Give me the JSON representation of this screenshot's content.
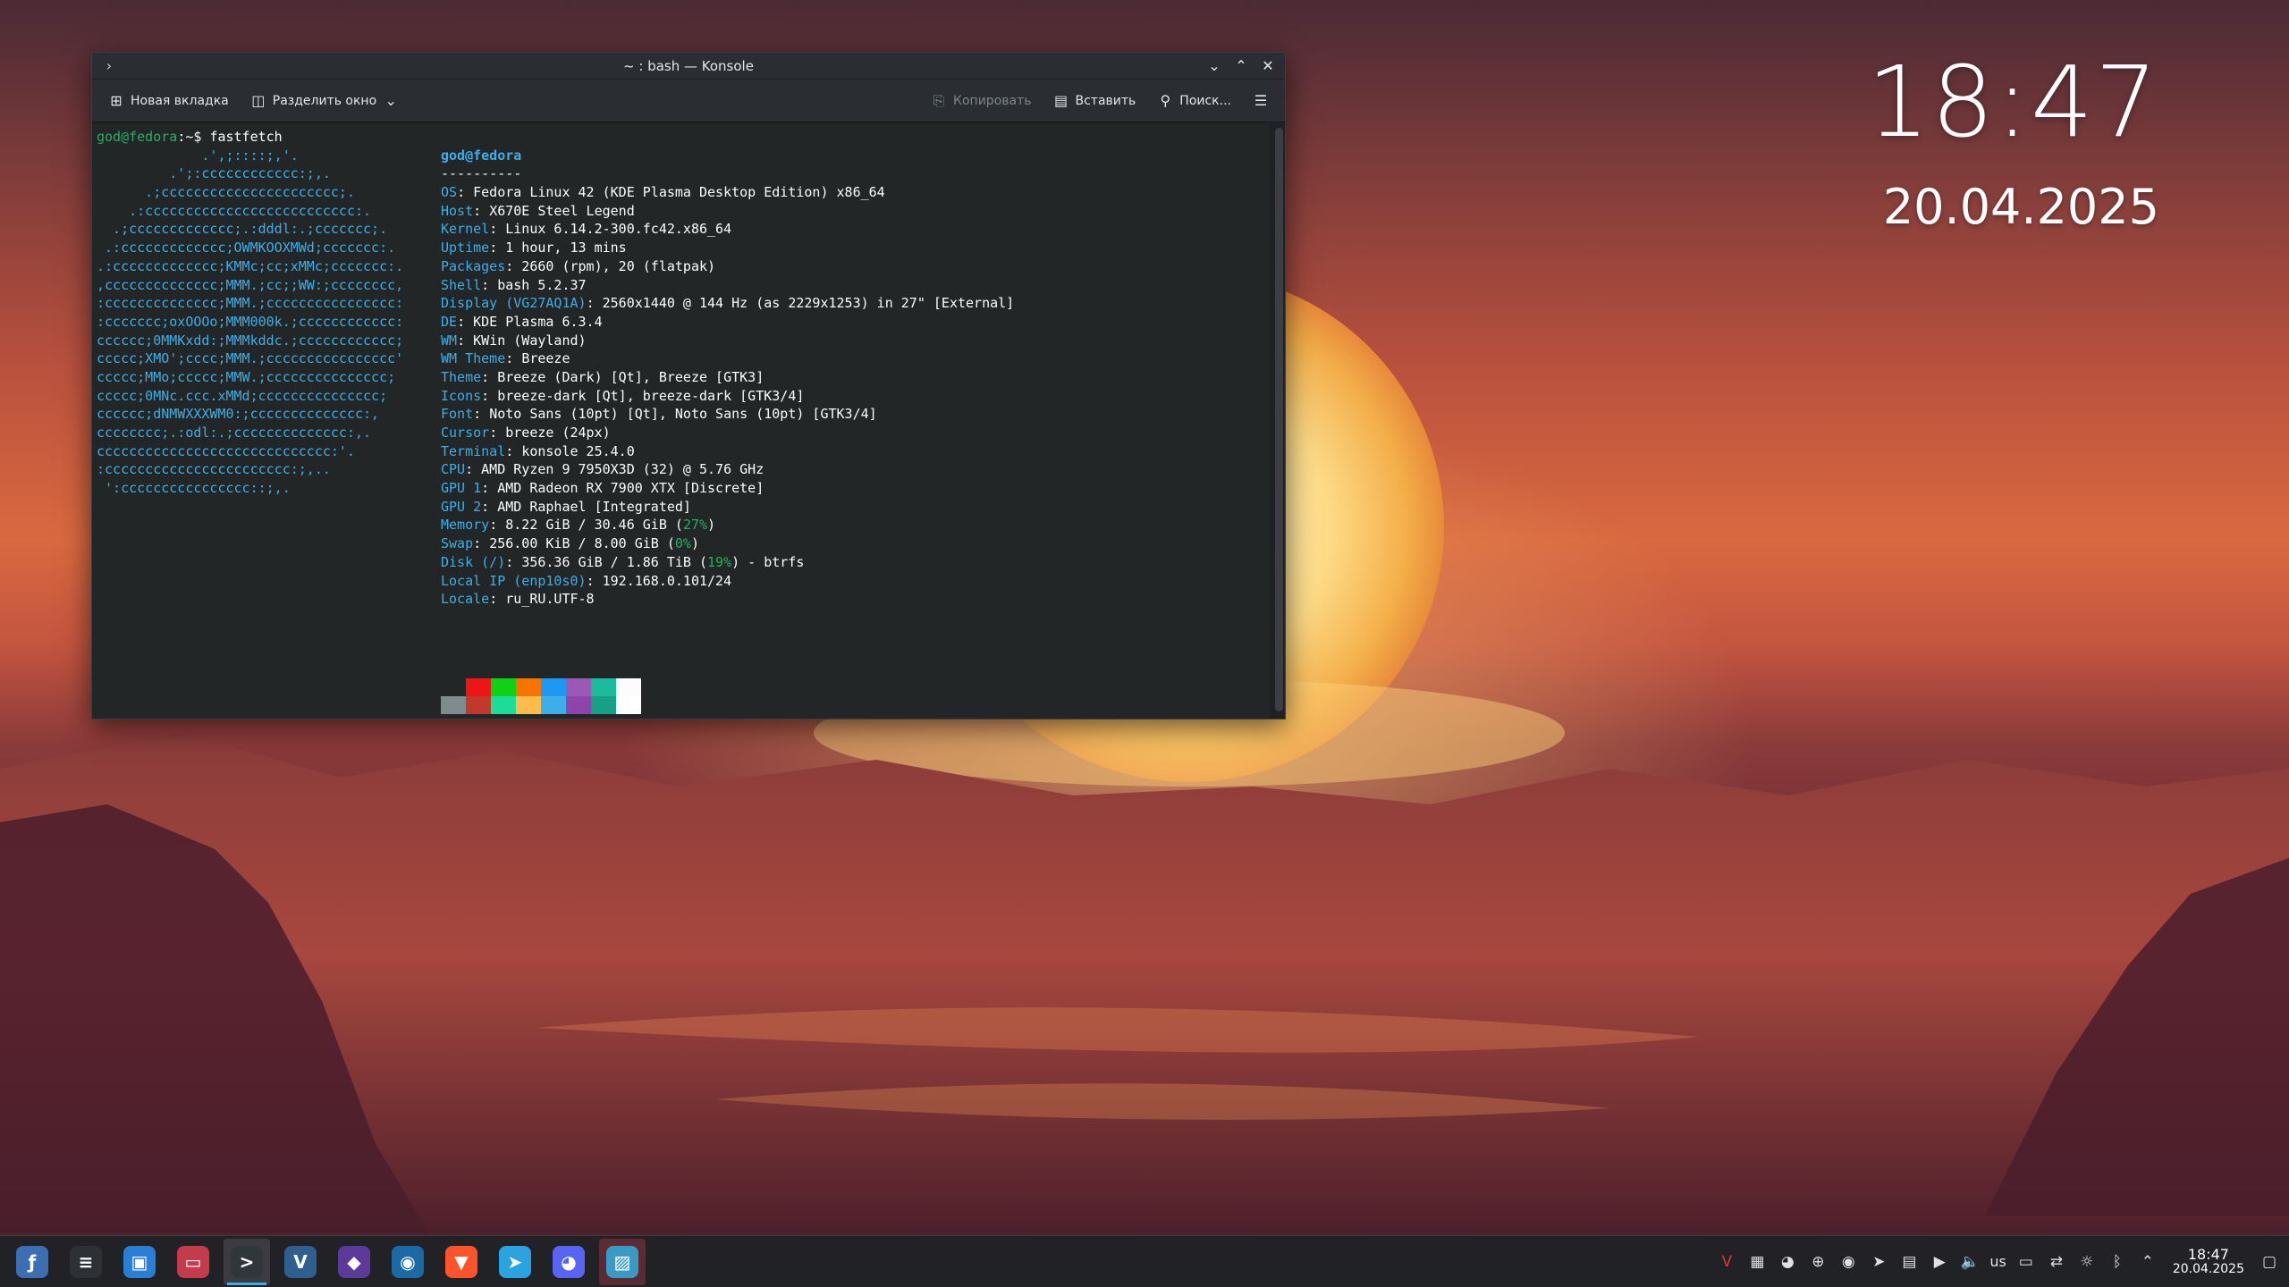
{
  "desktop": {
    "clock_time": "18:47",
    "clock_date": "20.04.2025"
  },
  "window": {
    "title": "~ : bash — Konsole",
    "app_icon": "terminal-chevron-icon",
    "controls": [
      "minimize",
      "maximize",
      "close"
    ]
  },
  "toolbar": {
    "new_tab": "Новая вкладка",
    "split_view": "Разделить окно",
    "copy": "Копировать",
    "paste": "Вставить",
    "find": "Поиск...",
    "menu_icon": "hamburger-menu-icon"
  },
  "terminal": {
    "prompt": "god@fedora",
    "prompt_suffix": ":~$ ",
    "command": "fastfetch",
    "logo_lines": [
      "             .',;::::;,'.",
      "         .';:cccccccccccc:;,.",
      "      .;cccccccccccccccccccccc;.",
      "    .:cccccccccccccccccccccccccc:.",
      "  .;ccccccccccccc;.:dddl:.;ccccccc;.",
      " .:ccccccccccccc;OWMKOOXMWd;ccccccc:.",
      ".:ccccccccccccc;KMMc;cc;xMMc;ccccccc:.",
      ",cccccccccccccc;MMM.;cc;;WW:;cccccccc,",
      ":cccccccccccccc;MMM.;cccccccccccccccc:",
      ":ccccccc;oxOOOo;MMM000k.;cccccccccccc:",
      "cccccc;0MMKxdd:;MMMkddc.;cccccccccccc;",
      "ccccc;XMO';cccc;MMM.;cccccccccccccccc'",
      "ccccc;MMo;ccccc;MMW.;ccccccccccccccc;",
      "ccccc;0MNc.ccc.xMMd;ccccccccccccccc;",
      "cccccc;dNMWXXXWM0:;cccccccccccccc:,",
      "cccccccc;.:odl:.;cccccccccccccc:,.",
      "ccccccccccccccccccccccccccccc:'.",
      ":ccccccccccccccccccccccc:;,..",
      " ':cccccccccccccccc::;,."
    ],
    "user_host": "god@fedora",
    "separator": "----------",
    "info": [
      {
        "k": "OS",
        "v": "Fedora Linux 42 (KDE Plasma Desktop Edition) x86_64"
      },
      {
        "k": "Host",
        "v": "X670E Steel Legend"
      },
      {
        "k": "Kernel",
        "v": "Linux 6.14.2-300.fc42.x86_64"
      },
      {
        "k": "Uptime",
        "v": "1 hour, 13 mins"
      },
      {
        "k": "Packages",
        "v": "2660 (rpm), 20 (flatpak)"
      },
      {
        "k": "Shell",
        "v": "bash 5.2.37"
      },
      {
        "k": "Display (VG27AQ1A)",
        "v": "2560x1440 @ 144 Hz (as 2229x1253) in 27\" [External]"
      },
      {
        "k": "DE",
        "v": "KDE Plasma 6.3.4"
      },
      {
        "k": "WM",
        "v": "KWin (Wayland)"
      },
      {
        "k": "WM Theme",
        "v": "Breeze"
      },
      {
        "k": "Theme",
        "v": "Breeze (Dark) [Qt], Breeze [GTK3]"
      },
      {
        "k": "Icons",
        "v": "breeze-dark [Qt], breeze-dark [GTK3/4]"
      },
      {
        "k": "Font",
        "v": "Noto Sans (10pt) [Qt], Noto Sans (10pt) [GTK3/4]"
      },
      {
        "k": "Cursor",
        "v": "breeze (24px)"
      },
      {
        "k": "Terminal",
        "v": "konsole 25.4.0"
      },
      {
        "k": "CPU",
        "v": "AMD Ryzen 9 7950X3D (32) @ 5.76 GHz"
      },
      {
        "k": "GPU 1",
        "v": "AMD Radeon RX 7900 XTX [Discrete]"
      },
      {
        "k": "GPU 2",
        "v": "AMD Raphael [Integrated]"
      }
    ],
    "memory": {
      "k": "Memory",
      "v_pre": "8.22 GiB / 30.46 GiB (",
      "pct": "27%",
      "v_post": ")"
    },
    "swap": {
      "k": "Swap",
      "v_pre": "256.00 KiB / 8.00 GiB (",
      "pct": "0%",
      "v_post": ")"
    },
    "disk": {
      "k": "Disk (/)",
      "v_pre": "356.36 GiB / 1.86 TiB (",
      "pct": "19%",
      "v_post": ") - btrfs"
    },
    "local_ip": {
      "k": "Local IP (enp10s0)",
      "v": "192.168.0.101/24"
    },
    "locale": {
      "k": "Locale",
      "v": "ru_RU.UTF-8"
    },
    "palette_top": [
      "#232627",
      "#ed1515",
      "#11d116",
      "#f67400",
      "#1d99f3",
      "#9b59b6",
      "#1abc9c",
      "#fcfcfc"
    ],
    "palette_bottom": [
      "#7f8c8d",
      "#c0392b",
      "#1cdc9a",
      "#fdbc4b",
      "#3daee9",
      "#8e44ad",
      "#16a085",
      "#ffffff"
    ]
  },
  "taskbar": {
    "apps": [
      {
        "name": "fedora-launcher-icon",
        "glyph": "ƒ",
        "color": "#3c6eb4"
      },
      {
        "name": "system-monitor-icon",
        "glyph": "≡",
        "color": "#2d3035"
      },
      {
        "name": "discover-store-icon",
        "glyph": "▣",
        "color": "#2a7fd4"
      },
      {
        "name": "file-manager-icon",
        "glyph": "▭",
        "color": "#c43c4c"
      },
      {
        "name": "konsole-icon",
        "glyph": ">",
        "color": "#31363b"
      },
      {
        "name": "vivaldi-icon",
        "glyph": "V",
        "color": "#2f5f8f"
      },
      {
        "name": "crystal-app-icon",
        "glyph": "◆",
        "color": "#5b3a9a"
      },
      {
        "name": "steam-icon",
        "glyph": "◉",
        "color": "#1b6aa6"
      },
      {
        "name": "brave-icon",
        "glyph": "▼",
        "color": "#fb542b"
      },
      {
        "name": "telegram-icon",
        "glyph": "➤",
        "color": "#2aa3e0"
      },
      {
        "name": "discord-icon",
        "glyph": "◕",
        "color": "#5865f2"
      },
      {
        "name": "screenshot-app-icon",
        "glyph": "▨",
        "color": "#3a9ac4"
      }
    ],
    "tray_lang": "us",
    "tray_time": "18:47",
    "tray_date": "20.04.2025"
  }
}
